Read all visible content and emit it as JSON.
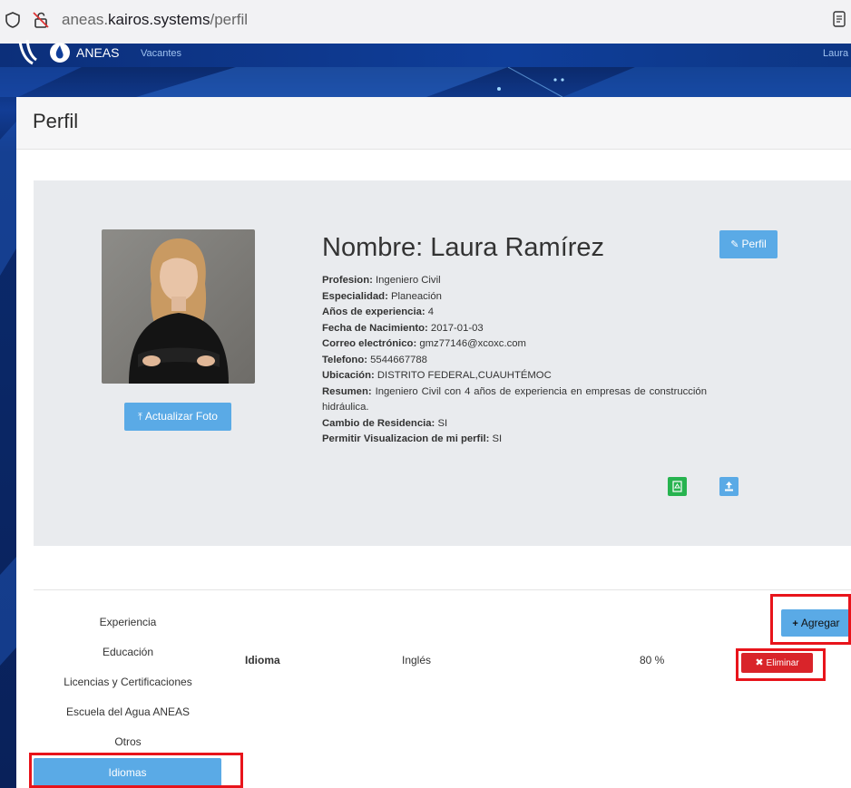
{
  "browser": {
    "url_prefix": "aneas.",
    "url_domain": "kairos.systems",
    "url_path": "/perfil"
  },
  "navbar": {
    "brand": "ANEAS",
    "vacantes": "Vacantes",
    "user": "Laura"
  },
  "page": {
    "title": "Perfil"
  },
  "profile": {
    "name": "Nombre: Laura Ramírez",
    "edit_button": "Perfil",
    "update_photo_button": "Actualizar Foto",
    "fields": [
      {
        "label": "Profesion:",
        "value": "Ingeniero Civil"
      },
      {
        "label": "Especialidad:",
        "value": "Planeación"
      },
      {
        "label": "Años de experiencia:",
        "value": "4"
      },
      {
        "label": "Fecha de Nacimiento:",
        "value": "2017-01-03"
      },
      {
        "label": "Correo electrónico:",
        "value": "gmz77146@xcoxc.com"
      },
      {
        "label": "Telefono:",
        "value": "5544667788"
      },
      {
        "label": "Ubicación:",
        "value": "DISTRITO FEDERAL,CUAUHTÉMOC"
      },
      {
        "label": "Resumen:",
        "value": "Ingeniero Civil con 4 años de experiencia en empresas de construcción hidráulica."
      },
      {
        "label": "Cambio de Residencia:",
        "value": "SI"
      },
      {
        "label": "Permitir Visualizacion de mi perfil:",
        "value": "SI"
      }
    ]
  },
  "sidebar": {
    "items": [
      {
        "label": "Experiencia"
      },
      {
        "label": "Educación"
      },
      {
        "label": "Licencias y Certificaciones"
      },
      {
        "label": "Escuela del Agua ANEAS"
      },
      {
        "label": "Otros"
      },
      {
        "label": "Idiomas"
      }
    ],
    "active_index": 5
  },
  "languages": {
    "add_button": "Agregar",
    "rows": [
      {
        "header": "Idioma",
        "language": "Inglés",
        "level": "80 %",
        "delete_button": "Eliminar"
      }
    ]
  },
  "colors": {
    "primary_button": "#5aaae6",
    "success_button": "#27b34f",
    "danger_button": "#d9242a",
    "navbar": "#0f3e9a",
    "highlight_box": "#e8141b"
  }
}
